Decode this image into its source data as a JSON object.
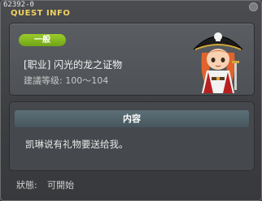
{
  "window": {
    "quest_code": "62392-0",
    "title": "QUEST INFO"
  },
  "quest": {
    "badge": "一般",
    "name": "[职业] 闪光的龙之证物",
    "level": "建議等级: 100～104"
  },
  "content": {
    "header": "内容",
    "text": "凯琳说有礼物要送给我。"
  },
  "status": {
    "label": "狀態:",
    "value": "可開始"
  },
  "icons": {
    "portrait": "pirate-captain-npc-icon",
    "close": "close-icon"
  },
  "colors": {
    "badge": "#86b923",
    "title": "#f0d060",
    "header": "#526570"
  }
}
